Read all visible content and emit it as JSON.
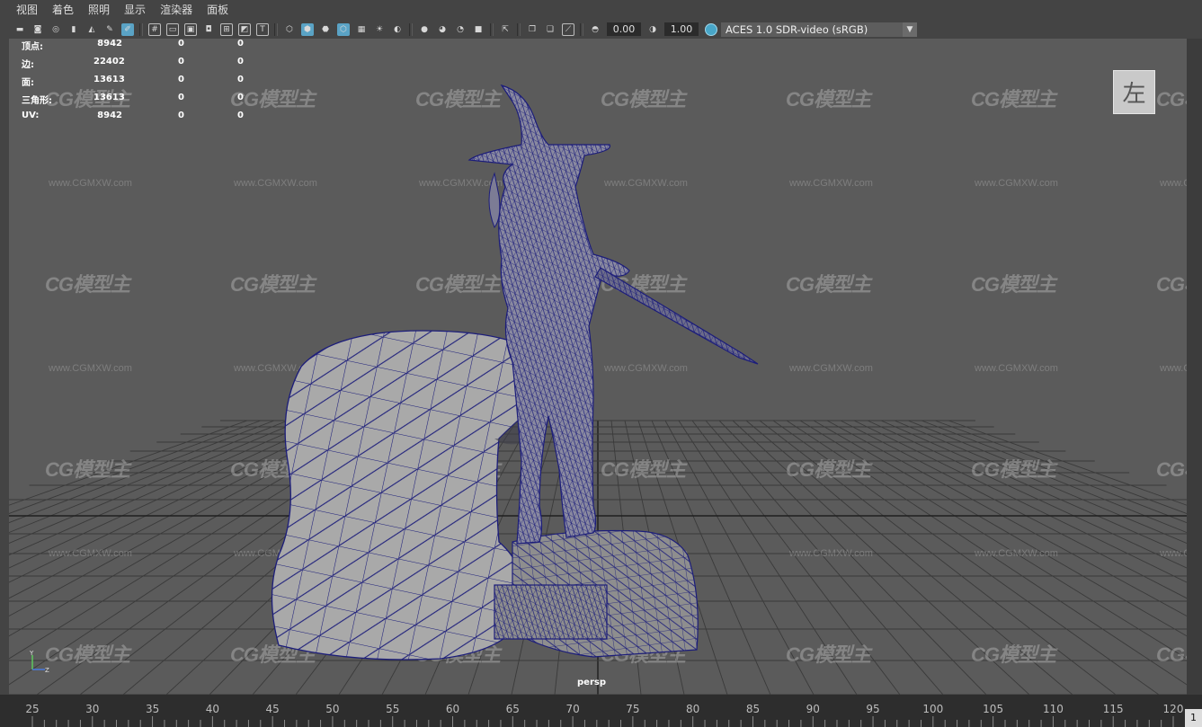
{
  "menu": [
    "视图",
    "着色",
    "照明",
    "显示",
    "渲染器",
    "面板"
  ],
  "toolbar": {
    "exposure": "0.00",
    "gamma": "1.00",
    "color_space": "ACES 1.0 SDR-video (sRGB)"
  },
  "hud": {
    "rows": [
      {
        "label": "顶点:",
        "v1": "8942",
        "v2": "0",
        "v3": "0"
      },
      {
        "label": "边:",
        "v1": "22402",
        "v2": "0",
        "v3": "0"
      },
      {
        "label": "面:",
        "v1": "13613",
        "v2": "0",
        "v3": "0"
      },
      {
        "label": "三角形:",
        "v1": "13613",
        "v2": "0",
        "v3": "0"
      },
      {
        "label": "UV:",
        "v1": "8942",
        "v2": "0",
        "v3": "0"
      }
    ]
  },
  "viewport": {
    "camera": "persp",
    "view_cube_face": "左",
    "axis_labels": {
      "y": "Y",
      "z": "Z"
    }
  },
  "watermark": {
    "logo": "CG模型主",
    "url": "www.CGMXW.com"
  },
  "timeline": {
    "ticks": [
      "25",
      "30",
      "35",
      "40",
      "45",
      "50",
      "55",
      "60",
      "65",
      "70",
      "75",
      "80",
      "85",
      "90",
      "95",
      "100",
      "105",
      "110",
      "115",
      "120"
    ],
    "current_frame": "1"
  },
  "colors": {
    "accent": "#5aa3c5",
    "wire": "#1c1d7a",
    "viewport_bg": "#5b5b5b"
  }
}
